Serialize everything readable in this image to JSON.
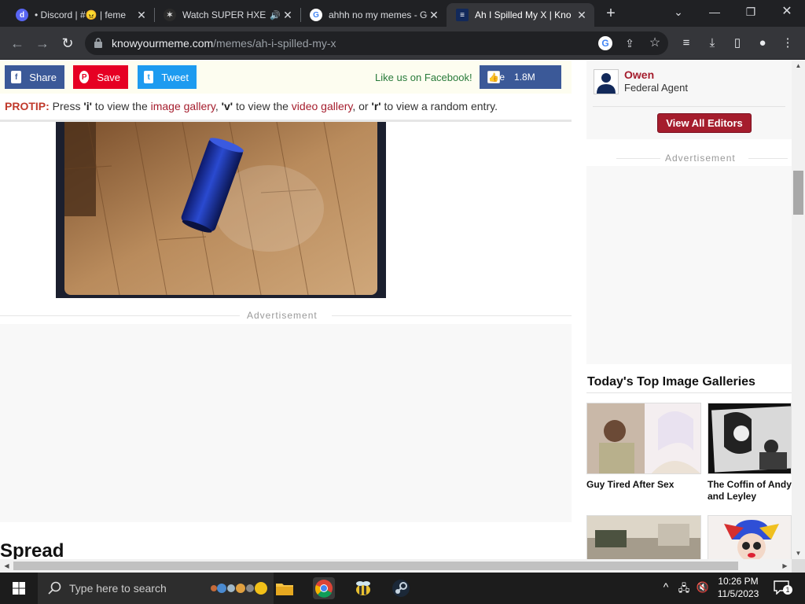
{
  "browser": {
    "tabs": [
      {
        "title": "• Discord | #😠 | feme",
        "icon": "discord-icon",
        "active": false
      },
      {
        "title": "Watch SUPER HXE",
        "icon": "anime-site-icon",
        "active": false,
        "audio": true
      },
      {
        "title": "ahhh no my memes - Go",
        "icon": "google-icon",
        "active": false
      },
      {
        "title": "Ah I Spilled My X | Kno",
        "icon": "kym-icon",
        "active": true
      }
    ],
    "url_host": "knowyourmeme.com",
    "url_path": "/memes/ah-i-spilled-my-x"
  },
  "sharebar": {
    "share": "Share",
    "save": "Save",
    "tweet": "Tweet",
    "fb_prompt": "Like us on Facebook!",
    "like": "Like",
    "like_count": "1.8M"
  },
  "protip": {
    "label": "PROTIP:",
    "t1": " Press ",
    "k1": "'i'",
    "t2": " to view the ",
    "l1": "image gallery",
    "t3": ", ",
    "k2": "'v'",
    "t4": " to view the ",
    "l2": "video gallery",
    "t5": ", or ",
    "k3": "'r'",
    "t6": " to view a random entry."
  },
  "ads": {
    "label": "Advertisement"
  },
  "section": {
    "spread": "Spread"
  },
  "sidebar": {
    "editor_name": "Owen",
    "editor_role": "Federal Agent",
    "view_all": "View All Editors",
    "galleries_title": "Today's Top Image Galleries",
    "galleries": [
      {
        "caption": "Guy Tired After Sex"
      },
      {
        "caption": "The Coffin of Andy and Leyley"
      },
      {
        "caption": ""
      },
      {
        "caption": ""
      }
    ]
  },
  "taskbar": {
    "search_placeholder": "Type here to search",
    "time": "10:26 PM",
    "date": "11/5/2023",
    "notifications": "1"
  }
}
